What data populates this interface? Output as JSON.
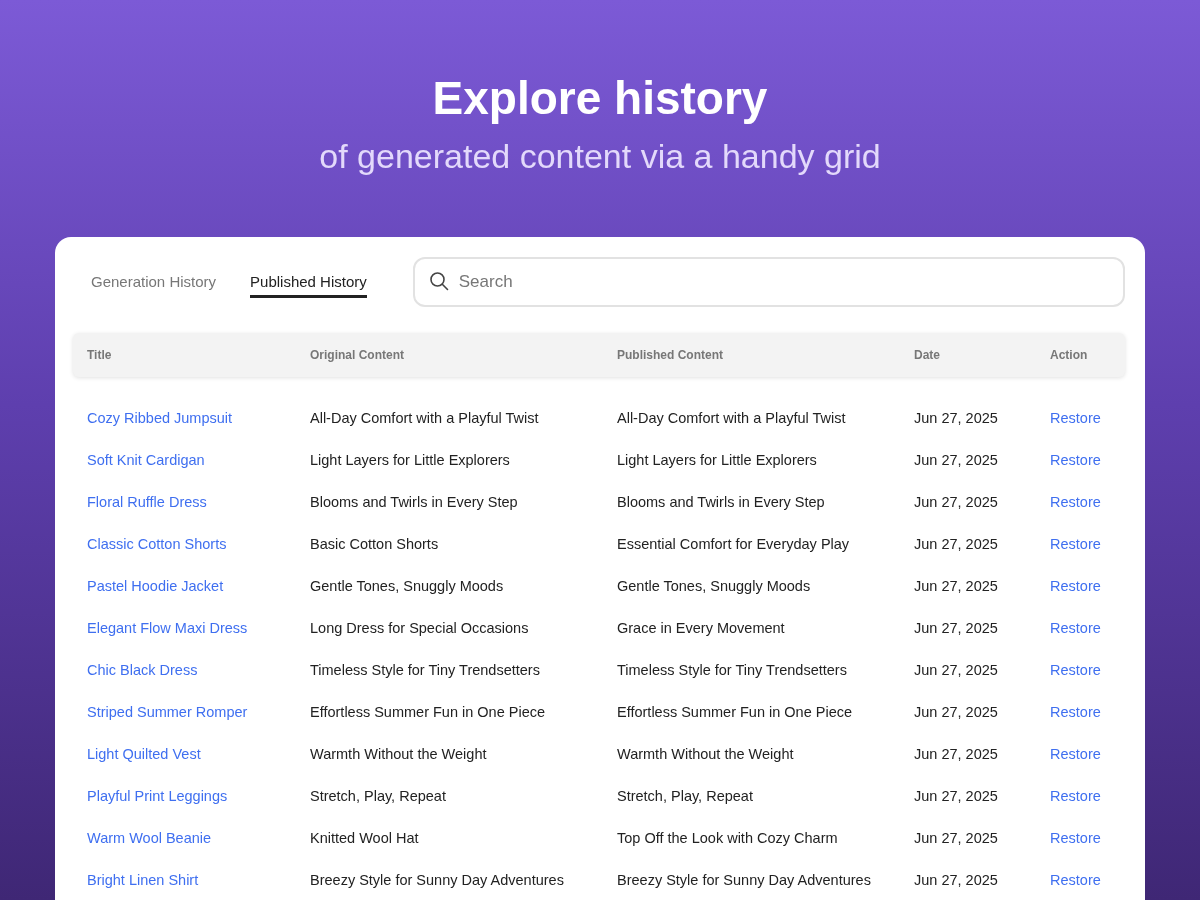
{
  "headline": "Explore history",
  "subheadline": "of generated content via a handy grid",
  "tabs": [
    {
      "label": "Generation History",
      "selected": false
    },
    {
      "label": "Published History",
      "selected": true
    }
  ],
  "search": {
    "placeholder": "Search"
  },
  "table": {
    "columns": [
      "Title",
      "Original Content",
      "Published Content",
      "Date",
      "Action"
    ],
    "rows": [
      {
        "title": "Cozy Ribbed Jumpsuit",
        "original": "All-Day Comfort with a Playful Twist",
        "published": "All-Day Comfort with a Playful Twist",
        "date": "Jun 27, 2025",
        "action": "Restore"
      },
      {
        "title": "Soft Knit Cardigan",
        "original": "Light Layers for Little Explorers",
        "published": "Light Layers for Little Explorers",
        "date": "Jun 27, 2025",
        "action": "Restore"
      },
      {
        "title": "Floral Ruffle Dress",
        "original": "Blooms and Twirls in Every Step",
        "published": "Blooms and Twirls in Every Step",
        "date": "Jun 27, 2025",
        "action": "Restore"
      },
      {
        "title": "Classic Cotton Shorts",
        "original": "Basic Cotton Shorts",
        "published": "Essential Comfort for Everyday Play",
        "date": "Jun 27, 2025",
        "action": "Restore"
      },
      {
        "title": "Pastel Hoodie Jacket",
        "original": "Gentle Tones, Snuggly Moods",
        "published": "Gentle Tones, Snuggly Moods",
        "date": "Jun 27, 2025",
        "action": "Restore"
      },
      {
        "title": "Elegant Flow Maxi Dress",
        "original": "Long Dress for Special Occasions",
        "published": "Grace in Every Movement",
        "date": "Jun 27, 2025",
        "action": "Restore"
      },
      {
        "title": "Chic Black Dress",
        "original": "Timeless Style for Tiny Trendsetters",
        "published": "Timeless Style for Tiny Trendsetters",
        "date": "Jun 27, 2025",
        "action": "Restore"
      },
      {
        "title": "Striped Summer Romper",
        "original": "Effortless Summer Fun in One Piece",
        "published": "Effortless Summer Fun in One Piece",
        "date": "Jun 27, 2025",
        "action": "Restore"
      },
      {
        "title": "Light Quilted Vest",
        "original": "Warmth Without the Weight",
        "published": "Warmth Without the Weight",
        "date": "Jun 27, 2025",
        "action": "Restore"
      },
      {
        "title": "Playful Print Leggings",
        "original": "Stretch, Play, Repeat",
        "published": "Stretch, Play, Repeat",
        "date": "Jun 27, 2025",
        "action": "Restore"
      },
      {
        "title": "Warm Wool Beanie",
        "original": "Knitted Wool Hat",
        "published": "Top Off the Look with Cozy Charm",
        "date": "Jun 27, 2025",
        "action": "Restore"
      },
      {
        "title": "Bright Linen Shirt",
        "original": "Breezy Style for Sunny Day Adventures",
        "published": "Breezy Style for Sunny Day Adventures",
        "date": "Jun 27, 2025",
        "action": "Restore"
      }
    ]
  }
}
